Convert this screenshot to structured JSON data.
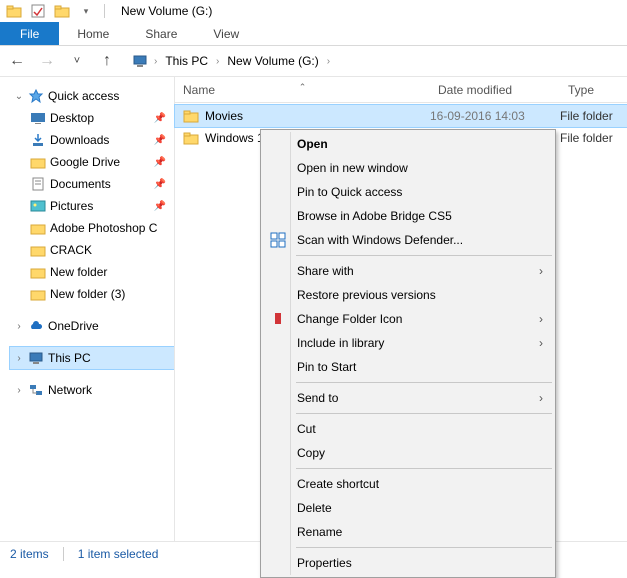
{
  "titlebar": {
    "title": "New Volume (G:)"
  },
  "ribbon": {
    "file": "File",
    "tabs": [
      "Home",
      "Share",
      "View"
    ]
  },
  "breadcrumbs": {
    "root": "This PC",
    "path": "New Volume (G:)"
  },
  "columns": {
    "name": "Name",
    "date": "Date modified",
    "type": "Type"
  },
  "sidebar": {
    "quick": "Quick access",
    "pinned": [
      {
        "label": "Desktop",
        "icon": "desktop"
      },
      {
        "label": "Downloads",
        "icon": "downloads"
      },
      {
        "label": "Google Drive",
        "icon": "folder"
      },
      {
        "label": "Documents",
        "icon": "documents"
      },
      {
        "label": "Pictures",
        "icon": "pictures"
      },
      {
        "label": "Adobe Photoshop C",
        "icon": "folder"
      },
      {
        "label": "CRACK",
        "icon": "folder"
      },
      {
        "label": "New folder",
        "icon": "folder"
      },
      {
        "label": "New folder (3)",
        "icon": "folder"
      }
    ],
    "onedrive": "OneDrive",
    "thispc": "This PC",
    "network": "Network"
  },
  "files": [
    {
      "name": "Movies",
      "date": "16-09-2016 14:03",
      "type": "File folder",
      "selected": true
    },
    {
      "name": "Windows 1",
      "date": "",
      "type": "File folder",
      "selected": false
    }
  ],
  "context": {
    "open": "Open",
    "open_new": "Open in new window",
    "pin_quick": "Pin to Quick access",
    "bridge": "Browse in Adobe Bridge CS5",
    "defender": "Scan with Windows Defender...",
    "share": "Share with",
    "restore": "Restore previous versions",
    "change_icon": "Change Folder Icon",
    "include": "Include in library",
    "pin_start": "Pin to Start",
    "send_to": "Send to",
    "cut": "Cut",
    "copy": "Copy",
    "shortcut": "Create shortcut",
    "delete": "Delete",
    "rename": "Rename",
    "props": "Properties"
  },
  "status": {
    "count": "2 items",
    "selected": "1 item selected"
  }
}
